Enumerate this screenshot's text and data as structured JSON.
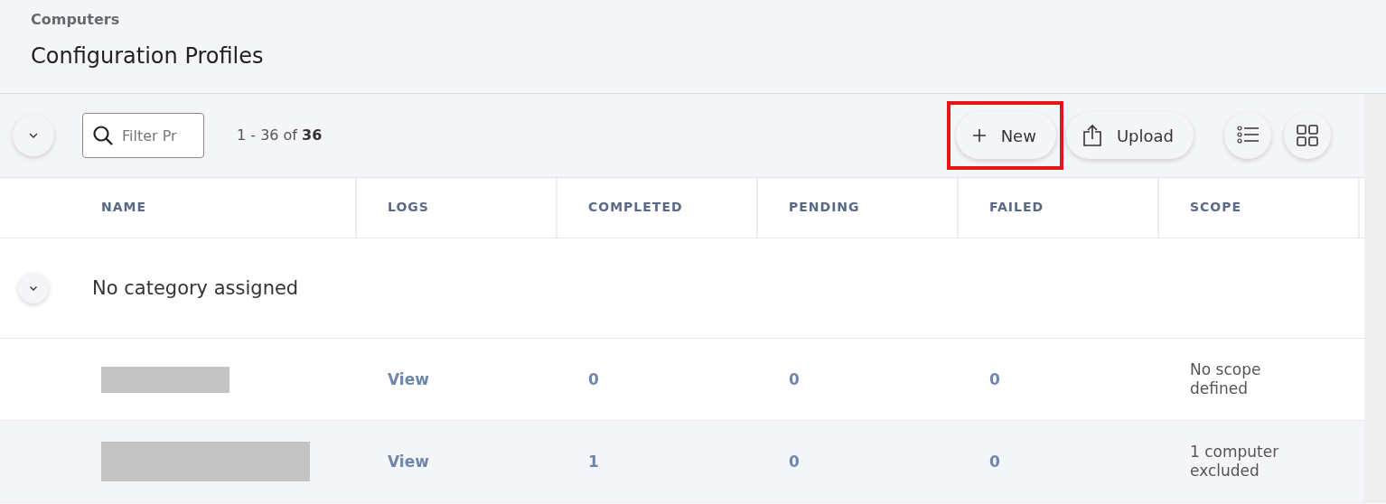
{
  "breadcrumb": "Computers",
  "title": "Configuration Profiles",
  "toolbar": {
    "filter": {
      "placeholder": "Filter Pr"
    },
    "count": "1 - 36 of **36**",
    "buttons": [
      {
        "kind": "new",
        "label": "New",
        "highlighted": true
      },
      {
        "kind": "upload",
        "label": "Upload",
        "highlighted": false
      }
    ],
    "views": [
      {
        "kind": "list"
      },
      {
        "kind": "grid"
      }
    ]
  },
  "table": {
    "columns": [
      "NAME",
      "LOGS",
      "COMPLETED",
      "PENDING",
      "FAILED",
      "SCOPE"
    ],
    "group": {
      "label": "No category assigned"
    },
    "rows": [
      {
        "name": {
          "kind": "redacted_short"
        },
        "logs": "View",
        "completed": "0",
        "pending": "0",
        "failed": "0",
        "scope": "No scope defined"
      },
      {
        "name": {
          "kind": "redacted_long"
        },
        "logs": "View",
        "completed": "1",
        "pending": "0",
        "failed": "0",
        "scope": "1 computer excluded"
      }
    ]
  }
}
